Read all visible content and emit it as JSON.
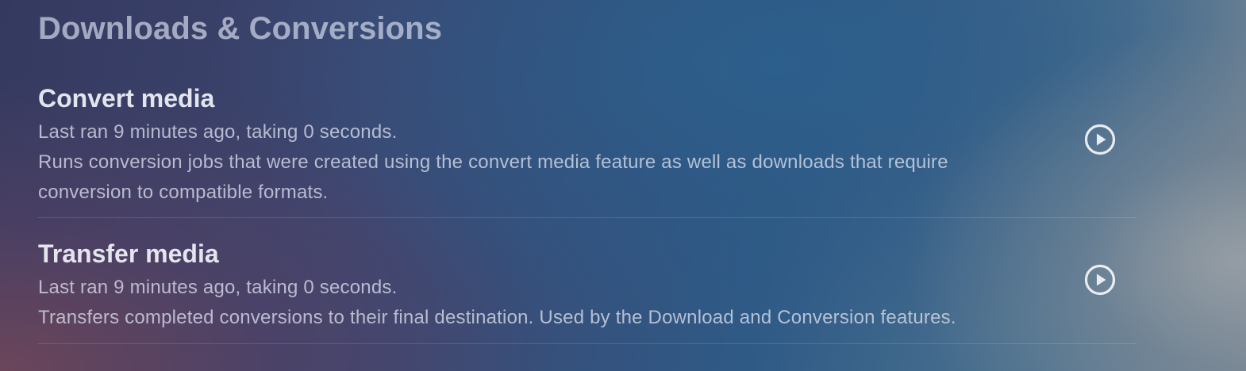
{
  "section": {
    "title": "Downloads & Conversions"
  },
  "tasks": [
    {
      "name": "Convert media",
      "last_run": "Last ran 9 minutes ago, taking 0 seconds.",
      "description": "Runs conversion jobs that were created using the convert media feature as well as downloads that require conversion to compatible formats.",
      "action_icon": "play-circle-icon"
    },
    {
      "name": "Transfer media",
      "last_run": "Last ran 9 minutes ago, taking 0 seconds.",
      "description": "Transfers completed conversions to their final destination. Used by the Download and Conversion features.",
      "action_icon": "play-circle-icon"
    }
  ]
}
